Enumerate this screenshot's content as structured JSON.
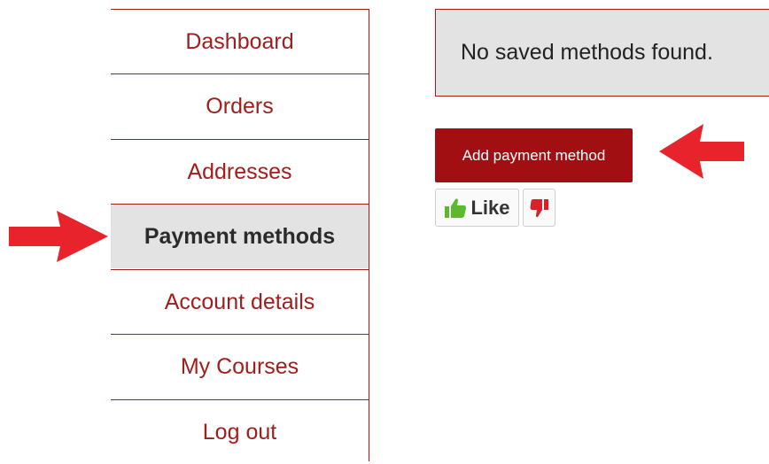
{
  "nav": {
    "items": [
      {
        "label": "Dashboard",
        "active": false
      },
      {
        "label": "Orders",
        "active": false
      },
      {
        "label": "Addresses",
        "active": false
      },
      {
        "label": "Payment methods",
        "active": true
      },
      {
        "label": "Account details",
        "active": false
      },
      {
        "label": "My Courses",
        "active": false
      },
      {
        "label": "Log out",
        "active": false
      }
    ]
  },
  "notice": {
    "text": "No saved methods found."
  },
  "actions": {
    "add_payment_label": "Add payment method"
  },
  "reactions": {
    "like_label": "Like",
    "like_icon": "thumbs-up-icon",
    "dislike_icon": "thumbs-down-icon",
    "like_color": "#5cb82e",
    "dislike_color": "#d8222a"
  },
  "colors": {
    "brand": "#a31d1d",
    "button": "#a20f13",
    "active_bg": "#e3e3e3",
    "annotation_arrow": "#e8232b"
  }
}
